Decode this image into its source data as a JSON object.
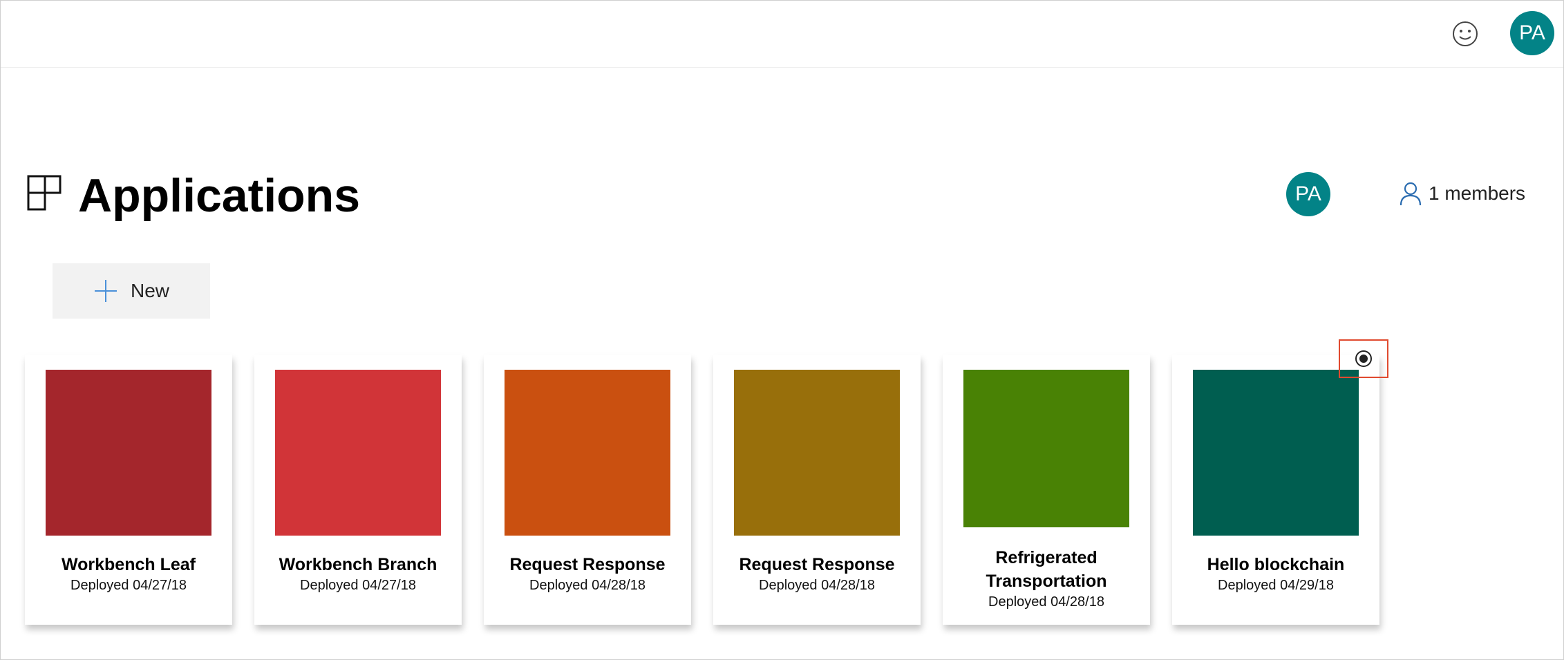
{
  "header": {
    "feedback_icon": "smiley-face-icon",
    "user_initials": "PA",
    "avatar_color": "#038387"
  },
  "page": {
    "title": "Applications",
    "title_icon": "applications-grid-icon",
    "members_label": "1 members",
    "members_icon": "person-icon",
    "owner_initials": "PA"
  },
  "toolbar": {
    "new_label": "New",
    "new_icon": "plus-icon"
  },
  "applications": [
    {
      "title": "Workbench Leaf",
      "deployed": "Deployed 04/27/18",
      "color": "#a4262c"
    },
    {
      "title": "Workbench Branch",
      "deployed": "Deployed 04/27/18",
      "color": "#d13438"
    },
    {
      "title": "Request Response",
      "deployed": "Deployed 04/28/18",
      "color": "#ca5010"
    },
    {
      "title": "Request Response",
      "deployed": "Deployed 04/28/18",
      "color": "#986f0b"
    },
    {
      "title": "Refrigerated Transportation",
      "deployed": "Deployed 04/28/18",
      "color": "#498205"
    },
    {
      "title": "Hello blockchain",
      "deployed": "Deployed 04/29/18",
      "color": "#005e50"
    }
  ],
  "selection": {
    "icon": "radio-selected-icon",
    "highlight_color": "#e04a2f"
  }
}
